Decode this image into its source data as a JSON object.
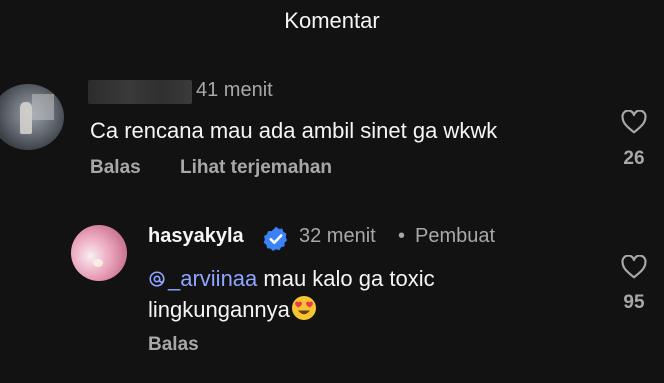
{
  "header": {
    "title": "Komentar"
  },
  "comments": [
    {
      "time": "41 menit",
      "text": "Ca rencana mau ada ambil sinet ga wkwk",
      "reply_label": "Balas",
      "translate_label": "Lihat terjemahan",
      "like_count": "26"
    },
    {
      "username": "hasyakyla",
      "time": "32 menit",
      "separator": "•",
      "author_badge": "Pembuat",
      "mention": "_arviinaa",
      "text_line1": " mau kalo ga toxic",
      "text_line2": "lingkungannya",
      "reply_label": "Balas",
      "like_count": "95"
    }
  ],
  "icons": {
    "like": "heart-outline-icon",
    "verified": "verified-badge-icon",
    "mention": "threads-at-icon",
    "emoji": "heart-eyes-emoji"
  },
  "colors": {
    "background": "#121212",
    "text": "#f5f5f5",
    "muted": "#a8a8a8",
    "mention": "#8fa4ff",
    "verified": "#3b82f6"
  }
}
